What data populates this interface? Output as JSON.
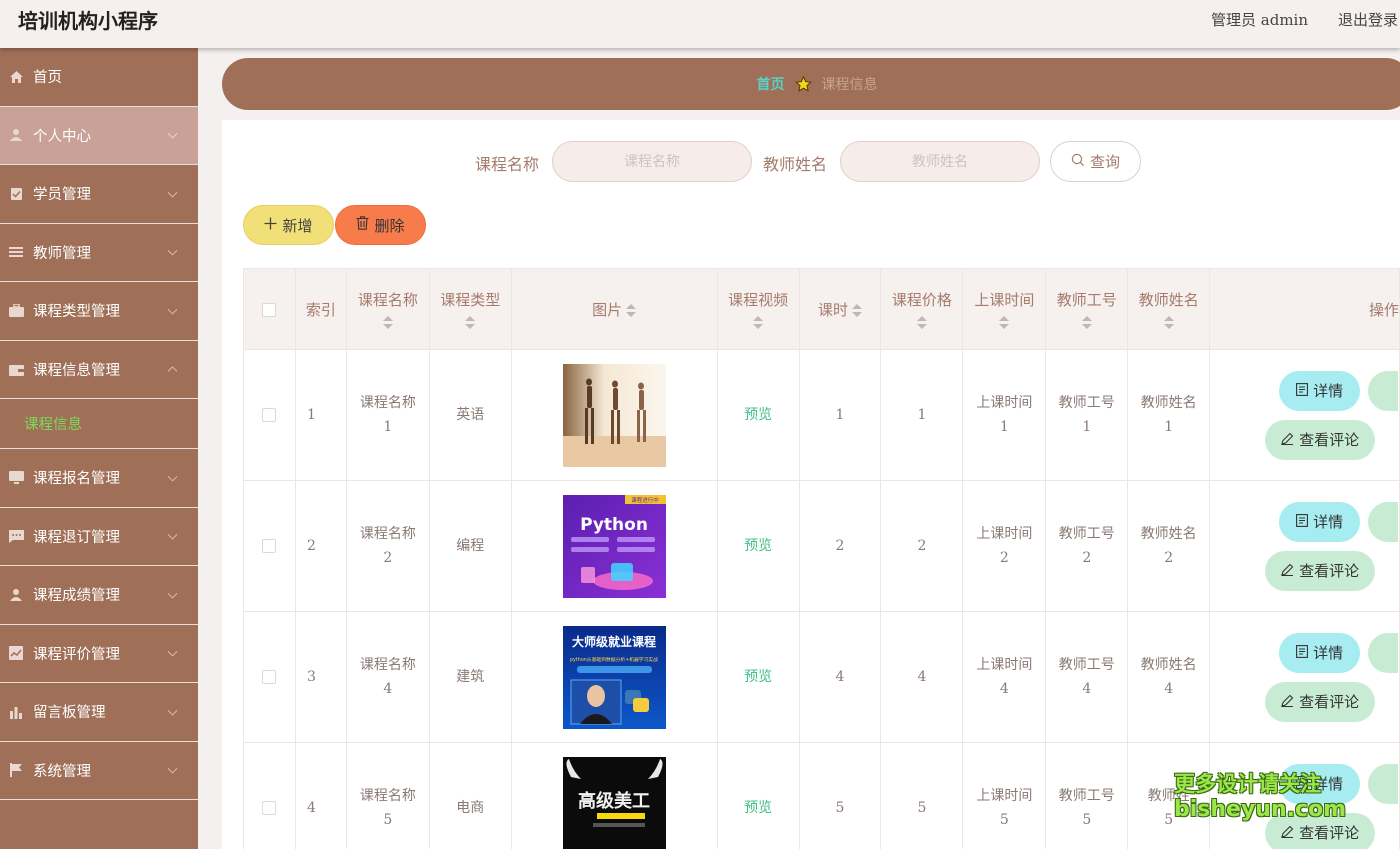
{
  "header": {
    "app_title": "培训机构小程序",
    "admin_label": "管理员 admin",
    "logout": "退出登录"
  },
  "sidebar": {
    "items": [
      {
        "label": "首页",
        "icon": "home-icon"
      },
      {
        "label": "个人中心",
        "icon": "user-icon"
      },
      {
        "label": "学员管理",
        "icon": "clipboard-icon"
      },
      {
        "label": "教师管理",
        "icon": "list-icon"
      },
      {
        "label": "课程类型管理",
        "icon": "briefcase-icon"
      },
      {
        "label": "课程信息管理",
        "icon": "wallet-icon"
      },
      {
        "label": "课程报名管理",
        "icon": "monitor-icon"
      },
      {
        "label": "课程退订管理",
        "icon": "message-icon"
      },
      {
        "label": "课程成绩管理",
        "icon": "person-icon"
      },
      {
        "label": "课程评价管理",
        "icon": "chart-icon"
      },
      {
        "label": "留言板管理",
        "icon": "bar-chart-icon"
      },
      {
        "label": "系统管理",
        "icon": "flag-icon"
      }
    ],
    "submenu": {
      "label": "课程信息"
    }
  },
  "breadcrumb": {
    "home": "首页",
    "current": "课程信息"
  },
  "search": {
    "course_name_label": "课程名称",
    "course_name_placeholder": "课程名称",
    "teacher_name_label": "教师姓名",
    "teacher_name_placeholder": "教师姓名",
    "query_label": "查询"
  },
  "toolbar": {
    "add_label": "新增",
    "delete_label": "删除"
  },
  "table": {
    "headers": {
      "index": "索引",
      "course_name": "课程名称",
      "course_type": "课程类型",
      "image": "图片",
      "video": "课程视频",
      "hours": "课时",
      "price": "课程价格",
      "time": "上课时间",
      "teacher_id": "教师工号",
      "teacher_name": "教师姓名",
      "actions": "操作"
    },
    "rows": [
      {
        "index": "1",
        "name_a": "课程名称",
        "name_b": "1",
        "type": "英语",
        "video": "预览",
        "hours": "1",
        "price": "1",
        "time_a": "上课时间",
        "time_b": "1",
        "tid_a": "教师工号",
        "tid_b": "1",
        "tname_a": "教师姓名",
        "tname_b": "1"
      },
      {
        "index": "2",
        "name_a": "课程名称",
        "name_b": "2",
        "type": "编程",
        "video": "预览",
        "hours": "2",
        "price": "2",
        "time_a": "上课时间",
        "time_b": "2",
        "tid_a": "教师工号",
        "tid_b": "2",
        "tname_a": "教师姓名",
        "tname_b": "2"
      },
      {
        "index": "3",
        "name_a": "课程名称",
        "name_b": "4",
        "type": "建筑",
        "video": "预览",
        "hours": "4",
        "price": "4",
        "time_a": "上课时间",
        "time_b": "4",
        "tid_a": "教师工号",
        "tid_b": "4",
        "tname_a": "教师姓名",
        "tname_b": "4"
      },
      {
        "index": "4",
        "name_a": "课程名称",
        "name_b": "5",
        "type": "电商",
        "video": "预览",
        "hours": "5",
        "price": "5",
        "time_a": "上课时间",
        "time_b": "5",
        "tid_a": "教师工号",
        "tid_b": "5",
        "tname_a": "教师姓",
        "tname_b": "5"
      }
    ],
    "detail_label": "详情",
    "comment_label": "查看评论"
  },
  "thumbs": {
    "python_title": "Python",
    "python_tag": "课程进行中",
    "master_title": "大师级就业课程",
    "master_sub": "python从基础到数据分析+机器学习实战",
    "ps_title": "高级美工"
  },
  "watermark": {
    "line1": "更多设计请关注",
    "line2": "bisheyun.com"
  },
  "colors": {
    "sidebar": "#a06f58",
    "active_menu": "#c9a196",
    "add_button": "#f1df77",
    "delete_button": "#f87c4b",
    "detail_button": "#a6ecf0",
    "comment_button": "#c8ecd3",
    "preview_link": "#3fbf87",
    "submenu_text": "#7cd957"
  }
}
